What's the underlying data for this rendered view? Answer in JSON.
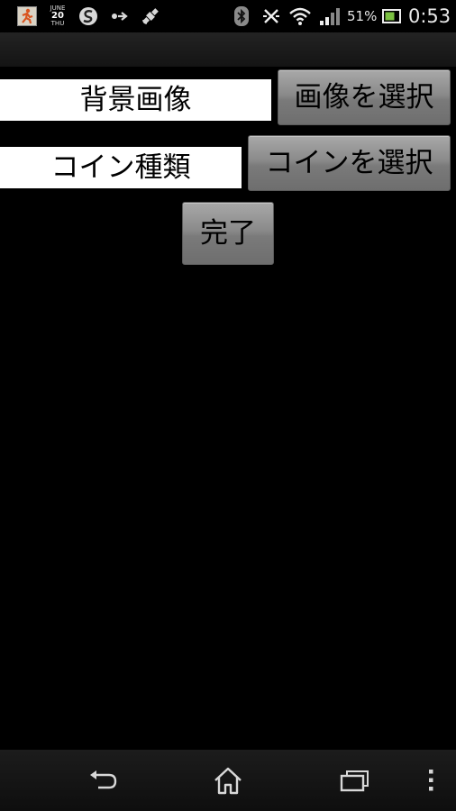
{
  "status_bar": {
    "date_month": "JUNE",
    "date_day": "20",
    "date_weekday": "THU",
    "battery_percent": "51%",
    "time": "0:53",
    "icons": [
      "notification-app-icon",
      "calendar-icon",
      "sync-icon",
      "data-arrows-icon",
      "gps-satellite-icon",
      "bluetooth-icon",
      "nfc-off-icon",
      "wifi-icon",
      "signal-icon",
      "battery-icon"
    ]
  },
  "settings": {
    "background_label": "背景画像",
    "select_image_button": "画像を選択",
    "coin_label": "コイン種類",
    "select_coin_button": "コインを選択",
    "done_button": "完了"
  },
  "nav_bar": {
    "icons": [
      "back-icon",
      "home-icon",
      "recent-apps-icon",
      "menu-icon"
    ]
  }
}
